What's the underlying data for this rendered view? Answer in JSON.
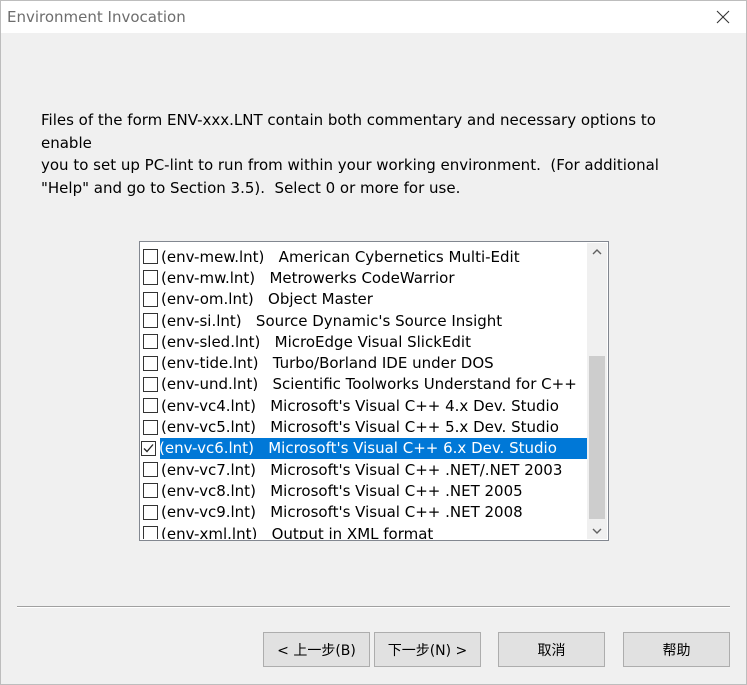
{
  "window": {
    "title": "Environment Invocation"
  },
  "description": "Files of the form ENV-xxx.LNT contain both commentary and necessary options to enable\nyou to set up PC-lint to run from within your working environment.  (For additional\n\"Help\" and go to Section 3.5).  Select 0 or more for use.",
  "list": {
    "items": [
      {
        "label": "(env-mew.lnt)   American Cybernetics Multi-Edit",
        "checked": false,
        "selected": false
      },
      {
        "label": "(env-mw.lnt)   Metrowerks CodeWarrior",
        "checked": false,
        "selected": false
      },
      {
        "label": "(env-om.lnt)   Object Master",
        "checked": false,
        "selected": false
      },
      {
        "label": "(env-si.lnt)   Source Dynamic's Source Insight",
        "checked": false,
        "selected": false
      },
      {
        "label": "(env-sled.lnt)   MicroEdge Visual SlickEdit",
        "checked": false,
        "selected": false
      },
      {
        "label": "(env-tide.lnt)   Turbo/Borland IDE under DOS",
        "checked": false,
        "selected": false
      },
      {
        "label": "(env-und.lnt)   Scientific Toolworks Understand for C++",
        "checked": false,
        "selected": false
      },
      {
        "label": "(env-vc4.lnt)   Microsoft's Visual C++ 4.x Dev. Studio",
        "checked": false,
        "selected": false
      },
      {
        "label": "(env-vc5.lnt)   Microsoft's Visual C++ 5.x Dev. Studio",
        "checked": false,
        "selected": false
      },
      {
        "label": "(env-vc6.lnt)   Microsoft's Visual C++ 6.x Dev. Studio",
        "checked": true,
        "selected": true
      },
      {
        "label": "(env-vc7.lnt)   Microsoft's Visual C++ .NET/.NET 2003",
        "checked": false,
        "selected": false
      },
      {
        "label": "(env-vc8.lnt)   Microsoft's Visual C++ .NET 2005",
        "checked": false,
        "selected": false
      },
      {
        "label": "(env-vc9.lnt)   Microsoft's Visual C++ .NET 2008",
        "checked": false,
        "selected": false
      },
      {
        "label": "(env-xml.lnt)   Output in XML format",
        "checked": false,
        "selected": false
      }
    ]
  },
  "buttons": {
    "back": "< 上一步(B)",
    "next": "下一步(N) >",
    "cancel": "取消",
    "help": "帮助"
  },
  "colors": {
    "selection": "#0078d7",
    "background": "#f0f0f0"
  }
}
